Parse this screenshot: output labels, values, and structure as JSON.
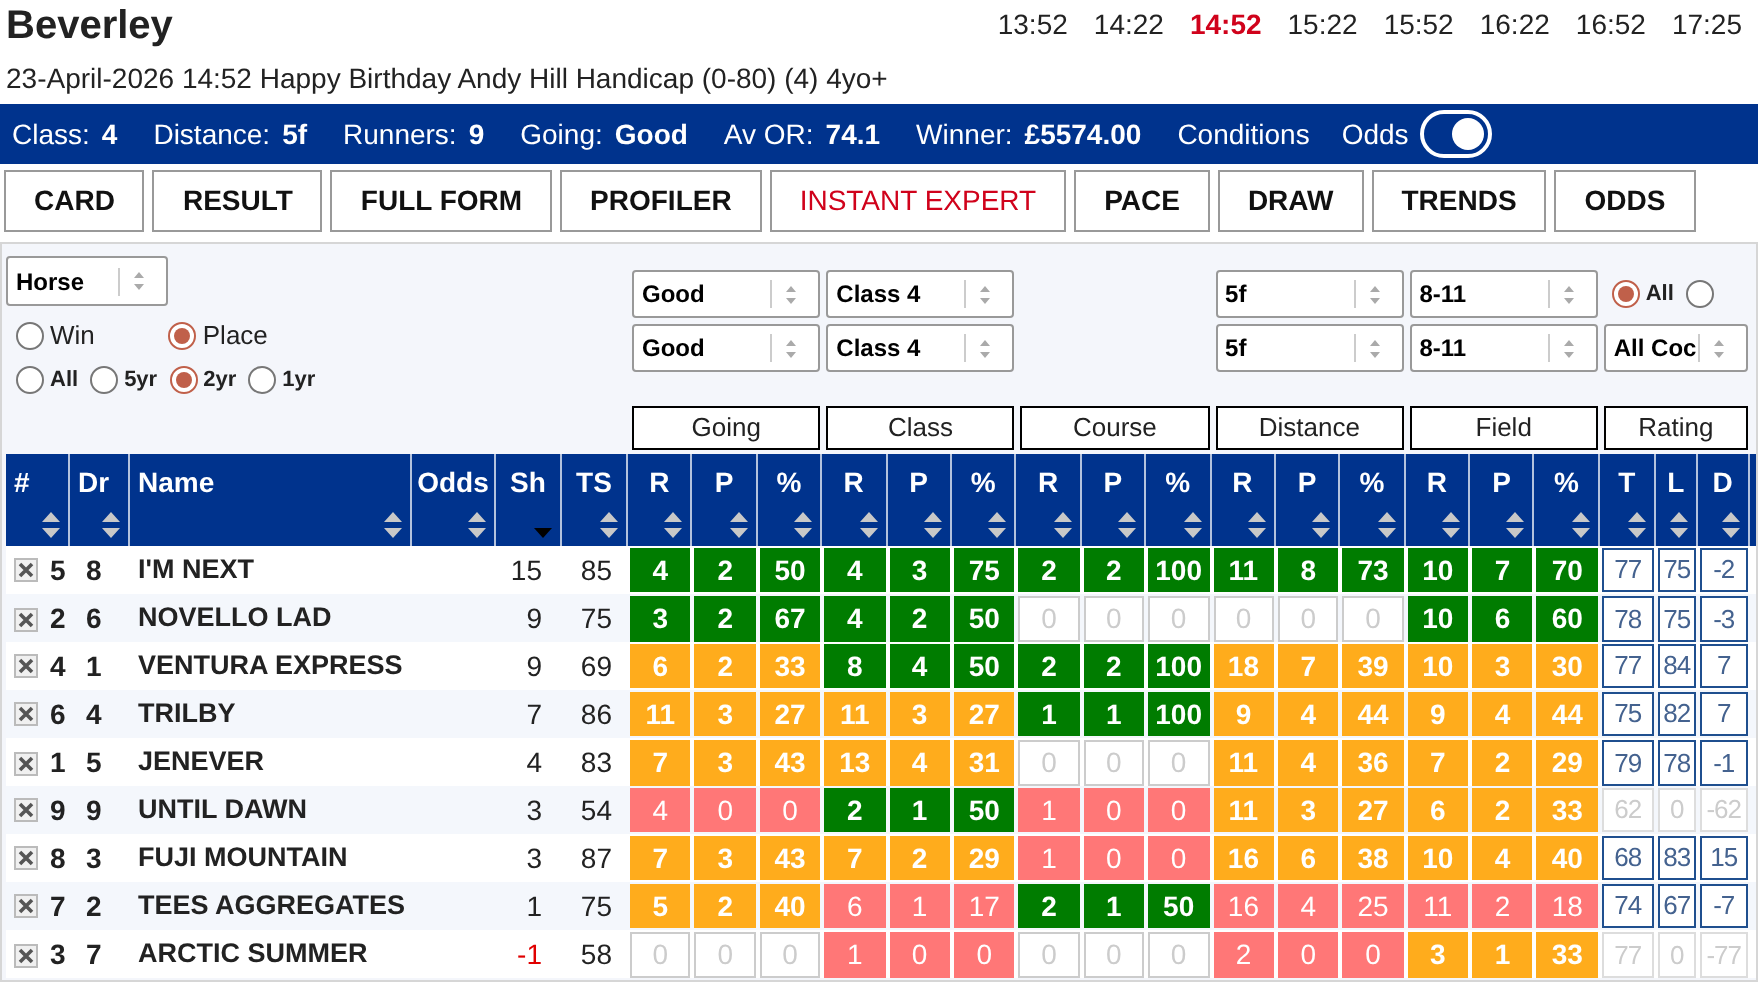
{
  "title": "Beverley",
  "times": [
    {
      "label": "13:52",
      "selected": false
    },
    {
      "label": "14:22",
      "selected": false
    },
    {
      "label": "14:52",
      "selected": true
    },
    {
      "label": "15:22",
      "selected": false
    },
    {
      "label": "15:52",
      "selected": false
    },
    {
      "label": "16:22",
      "selected": false
    },
    {
      "label": "16:52",
      "selected": false
    },
    {
      "label": "17:25",
      "selected": false
    }
  ],
  "race_title": "23-April-2026 14:52 Happy Birthday Andy Hill Handicap (0-80) (4) 4yo+",
  "info_bar": {
    "items": [
      {
        "label": "Class:",
        "value": "4"
      },
      {
        "label": "Distance:",
        "value": "5f"
      },
      {
        "label": "Runners:",
        "value": "9"
      },
      {
        "label": "Going:",
        "value": "Good"
      },
      {
        "label": "Av OR:",
        "value": "74.1"
      },
      {
        "label": "Winner:",
        "value": "£5574.00"
      }
    ],
    "conditions": "Conditions",
    "odds_toggle": {
      "label": "Odds",
      "on": true
    }
  },
  "tabs": [
    {
      "label": "CARD",
      "selected": false
    },
    {
      "label": "RESULT",
      "selected": false
    },
    {
      "label": "FULL FORM",
      "selected": false
    },
    {
      "label": "PROFILER",
      "selected": false
    },
    {
      "label": "INSTANT EXPERT",
      "selected": true
    },
    {
      "label": "PACE",
      "selected": false
    },
    {
      "label": "DRAW",
      "selected": false
    },
    {
      "label": "TRENDS",
      "selected": false
    },
    {
      "label": "ODDS",
      "selected": false
    }
  ],
  "view_select": "Horse",
  "result_type": [
    {
      "label": "Win",
      "selected": false
    },
    {
      "label": "Place",
      "selected": true
    }
  ],
  "period": [
    {
      "label": "All",
      "selected": false
    },
    {
      "label": "5yr",
      "selected": false
    },
    {
      "label": "2yr",
      "selected": true
    },
    {
      "label": "1yr",
      "selected": false
    }
  ],
  "filters_row_1": {
    "going": "Good",
    "class": "Class 4",
    "distance": "5f",
    "field": "8-11"
  },
  "filters_row_2": {
    "going": "Good",
    "class": "Class 4",
    "distance": "5f",
    "field": "8-11",
    "rating": "All Coc"
  },
  "rating_scope": [
    {
      "label": "All",
      "selected": true
    },
    {
      "selected": false
    }
  ],
  "groups": [
    "Going",
    "Class",
    "Course",
    "Distance",
    "Field",
    "Rating"
  ],
  "columns": [
    {
      "label": "#",
      "sorted": false
    },
    {
      "label": "Dr",
      "sorted": false
    },
    {
      "label": "Name",
      "sorted": false
    },
    {
      "label": "Odds",
      "sorted": false
    },
    {
      "label": "Sh",
      "sorted": true
    },
    {
      "label": "TS",
      "sorted": false
    },
    {
      "label": "R",
      "sorted": false
    },
    {
      "label": "P",
      "sorted": false
    },
    {
      "label": "%",
      "sorted": false
    },
    {
      "label": "R",
      "sorted": false
    },
    {
      "label": "P",
      "sorted": false
    },
    {
      "label": "%",
      "sorted": false
    },
    {
      "label": "R",
      "sorted": false
    },
    {
      "label": "P",
      "sorted": false
    },
    {
      "label": "%",
      "sorted": false
    },
    {
      "label": "R",
      "sorted": false
    },
    {
      "label": "P",
      "sorted": false
    },
    {
      "label": "%",
      "sorted": false
    },
    {
      "label": "R",
      "sorted": false
    },
    {
      "label": "P",
      "sorted": false
    },
    {
      "label": "%",
      "sorted": false
    },
    {
      "label": "T",
      "sorted": false
    },
    {
      "label": "L",
      "sorted": false
    },
    {
      "label": "D",
      "sorted": false
    }
  ],
  "rows": [
    {
      "no": "5",
      "draw": "8",
      "name": "I'M NEXT",
      "sh": "15",
      "sh_alert": false,
      "ts": "85",
      "stats": [
        {
          "color": "#007c00",
          "values": [
            "4",
            "2",
            "50"
          ]
        },
        {
          "color": "#007c00",
          "values": [
            "4",
            "3",
            "75"
          ]
        },
        {
          "color": "#007c00",
          "values": [
            "2",
            "2",
            "100"
          ]
        },
        {
          "color": "#007c00",
          "values": [
            "11",
            "8",
            "73"
          ]
        },
        {
          "color": "#007c00",
          "values": [
            "10",
            "7",
            "70"
          ]
        }
      ],
      "rating": {
        "active": true,
        "values": [
          "77",
          "75",
          "-2"
        ]
      }
    },
    {
      "no": "2",
      "draw": "6",
      "name": "NOVELLO LAD",
      "sh": "9",
      "sh_alert": false,
      "ts": "75",
      "stats": [
        {
          "color": "#007c00",
          "values": [
            "3",
            "2",
            "67"
          ]
        },
        {
          "color": "#007c00",
          "values": [
            "4",
            "2",
            "50"
          ]
        },
        {
          "color": "#ffffff",
          "values": [
            "0",
            "0",
            "0"
          ]
        },
        {
          "color": "#ffffff",
          "values": [
            "0",
            "0",
            "0"
          ]
        },
        {
          "color": "#007c00",
          "values": [
            "10",
            "6",
            "60"
          ]
        }
      ],
      "rating": {
        "active": true,
        "values": [
          "78",
          "75",
          "-3"
        ]
      }
    },
    {
      "no": "4",
      "draw": "1",
      "name": "VENTURA EXPRESS",
      "sh": "9",
      "sh_alert": false,
      "ts": "69",
      "stats": [
        {
          "color": "#ffac1c",
          "values": [
            "6",
            "2",
            "33"
          ]
        },
        {
          "color": "#007c00",
          "values": [
            "8",
            "4",
            "50"
          ]
        },
        {
          "color": "#007c00",
          "values": [
            "2",
            "2",
            "100"
          ]
        },
        {
          "color": "#ffac1c",
          "values": [
            "18",
            "7",
            "39"
          ]
        },
        {
          "color": "#ffac1c",
          "values": [
            "10",
            "3",
            "30"
          ]
        }
      ],
      "rating": {
        "active": true,
        "values": [
          "77",
          "84",
          "7"
        ]
      }
    },
    {
      "no": "6",
      "draw": "4",
      "name": "TRILBY",
      "sh": "7",
      "sh_alert": false,
      "ts": "86",
      "stats": [
        {
          "color": "#ffac1c",
          "values": [
            "11",
            "3",
            "27"
          ]
        },
        {
          "color": "#ffac1c",
          "values": [
            "11",
            "3",
            "27"
          ]
        },
        {
          "color": "#007c00",
          "values": [
            "1",
            "1",
            "100"
          ]
        },
        {
          "color": "#ffac1c",
          "values": [
            "9",
            "4",
            "44"
          ]
        },
        {
          "color": "#ffac1c",
          "values": [
            "9",
            "4",
            "44"
          ]
        }
      ],
      "rating": {
        "active": true,
        "values": [
          "75",
          "82",
          "7"
        ]
      }
    },
    {
      "no": "1",
      "draw": "5",
      "name": "JENEVER",
      "sh": "4",
      "sh_alert": false,
      "ts": "83",
      "stats": [
        {
          "color": "#ffac1c",
          "values": [
            "7",
            "3",
            "43"
          ]
        },
        {
          "color": "#ffac1c",
          "values": [
            "13",
            "4",
            "31"
          ]
        },
        {
          "color": "#ffffff",
          "values": [
            "0",
            "0",
            "0"
          ]
        },
        {
          "color": "#ffac1c",
          "values": [
            "11",
            "4",
            "36"
          ]
        },
        {
          "color": "#ffac1c",
          "values": [
            "7",
            "2",
            "29"
          ]
        }
      ],
      "rating": {
        "active": true,
        "values": [
          "79",
          "78",
          "-1"
        ]
      }
    },
    {
      "no": "9",
      "draw": "9",
      "name": "UNTIL DAWN",
      "sh": "3",
      "sh_alert": false,
      "ts": "54",
      "stats": [
        {
          "color": "#ff7777",
          "values": [
            "4",
            "0",
            "0"
          ]
        },
        {
          "color": "#007c00",
          "values": [
            "2",
            "1",
            "50"
          ]
        },
        {
          "color": "#ff7777",
          "values": [
            "1",
            "0",
            "0"
          ]
        },
        {
          "color": "#ffac1c",
          "values": [
            "11",
            "3",
            "27"
          ]
        },
        {
          "color": "#ffac1c",
          "values": [
            "6",
            "2",
            "33"
          ]
        }
      ],
      "rating": {
        "active": false,
        "values": [
          "62",
          "0",
          "-62"
        ]
      }
    },
    {
      "no": "8",
      "draw": "3",
      "name": "FUJI MOUNTAIN",
      "sh": "3",
      "sh_alert": false,
      "ts": "87",
      "stats": [
        {
          "color": "#ffac1c",
          "values": [
            "7",
            "3",
            "43"
          ]
        },
        {
          "color": "#ffac1c",
          "values": [
            "7",
            "2",
            "29"
          ]
        },
        {
          "color": "#ff7777",
          "values": [
            "1",
            "0",
            "0"
          ]
        },
        {
          "color": "#ffac1c",
          "values": [
            "16",
            "6",
            "38"
          ]
        },
        {
          "color": "#ffac1c",
          "values": [
            "10",
            "4",
            "40"
          ]
        }
      ],
      "rating": {
        "active": true,
        "values": [
          "68",
          "83",
          "15"
        ]
      }
    },
    {
      "no": "7",
      "draw": "2",
      "name": "TEES AGGREGATES",
      "sh": "1",
      "sh_alert": false,
      "ts": "75",
      "stats": [
        {
          "color": "#ffac1c",
          "values": [
            "5",
            "2",
            "40"
          ]
        },
        {
          "color": "#ff7777",
          "values": [
            "6",
            "1",
            "17"
          ]
        },
        {
          "color": "#007c00",
          "values": [
            "2",
            "1",
            "50"
          ]
        },
        {
          "color": "#ff7777",
          "values": [
            "16",
            "4",
            "25"
          ]
        },
        {
          "color": "#ff7777",
          "values": [
            "11",
            "2",
            "18"
          ]
        }
      ],
      "rating": {
        "active": true,
        "values": [
          "74",
          "67",
          "-7"
        ]
      }
    },
    {
      "no": "3",
      "draw": "7",
      "name": "ARCTIC SUMMER",
      "sh": "-1",
      "sh_alert": true,
      "ts": "58",
      "stats": [
        {
          "color": "#ffffff",
          "values": [
            "0",
            "0",
            "0"
          ]
        },
        {
          "color": "#ff7777",
          "values": [
            "1",
            "0",
            "0"
          ]
        },
        {
          "color": "#ffffff",
          "values": [
            "0",
            "0",
            "0"
          ]
        },
        {
          "color": "#ff7777",
          "values": [
            "2",
            "0",
            "0"
          ]
        },
        {
          "color": "#ffac1c",
          "values": [
            "3",
            "1",
            "33"
          ]
        }
      ],
      "rating": {
        "active": false,
        "values": [
          "77",
          "0",
          "-77"
        ]
      }
    }
  ]
}
